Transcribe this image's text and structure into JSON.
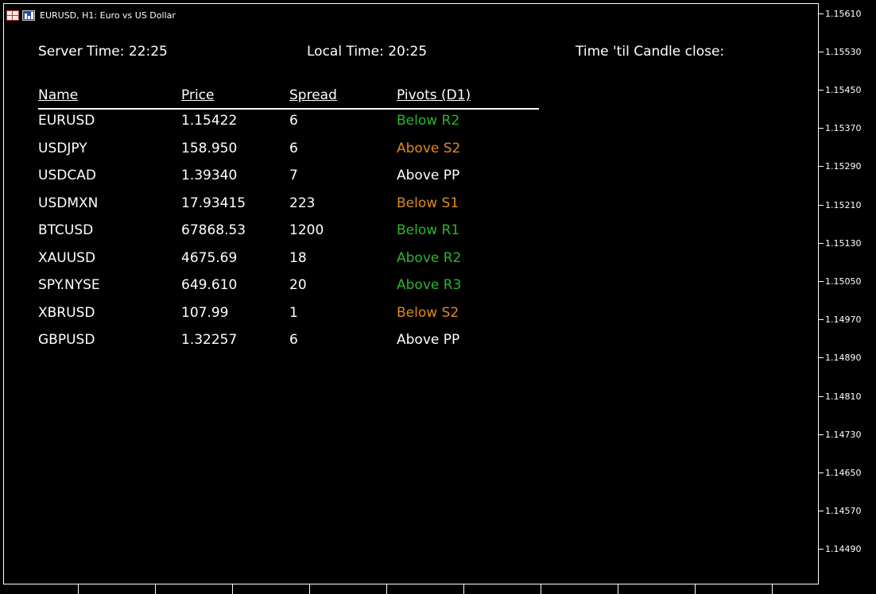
{
  "window": {
    "title": "EURUSD, H1:  Euro vs US Dollar"
  },
  "header": {
    "server_time": "Server Time: 22:25",
    "local_time": "Local Time: 20:25",
    "candle_close": "Time 'til Candle close:"
  },
  "table": {
    "columns": [
      "Name",
      "Price",
      "Spread",
      "Pivots (D1)"
    ],
    "rows": [
      {
        "name": "EURUSD",
        "price": "1.15422",
        "spread": "6",
        "pivot": "Below R2",
        "pivot_color": "#2bb52b"
      },
      {
        "name": "USDJPY",
        "price": "158.950",
        "spread": "6",
        "pivot": "Above S2",
        "pivot_color": "#e08a1e"
      },
      {
        "name": "USDCAD",
        "price": "1.39340",
        "spread": "7",
        "pivot": "Above PP",
        "pivot_color": "#ffffff"
      },
      {
        "name": "USDMXN",
        "price": "17.93415",
        "spread": "223",
        "pivot": "Below S1",
        "pivot_color": "#e08a1e"
      },
      {
        "name": "BTCUSD",
        "price": "67868.53",
        "spread": "1200",
        "pivot": "Below R1",
        "pivot_color": "#2bb52b"
      },
      {
        "name": "XAUUSD",
        "price": "4675.69",
        "spread": "18",
        "pivot": "Above R2",
        "pivot_color": "#2bb52b"
      },
      {
        "name": "SPY.NYSE",
        "price": "649.610",
        "spread": "20",
        "pivot": "Above R3",
        "pivot_color": "#2bb52b"
      },
      {
        "name": "XBRUSD",
        "price": "107.99",
        "spread": "1",
        "pivot": "Below S2",
        "pivot_color": "#e08a1e"
      },
      {
        "name": "GBPUSD",
        "price": "1.32257",
        "spread": "6",
        "pivot": "Above PP",
        "pivot_color": "#ffffff"
      }
    ]
  },
  "price_axis": {
    "labels": [
      "1.15610",
      "1.15530",
      "1.15450",
      "1.15370",
      "1.15290",
      "1.15210",
      "1.15130",
      "1.15050",
      "1.14970",
      "1.14890",
      "1.14810",
      "1.14730",
      "1.14650",
      "1.14570",
      "1.14490"
    ]
  },
  "colors": {
    "background": "#000000",
    "text": "#ffffff",
    "bullish": "#2bb52b",
    "bearish": "#e08a1e"
  }
}
